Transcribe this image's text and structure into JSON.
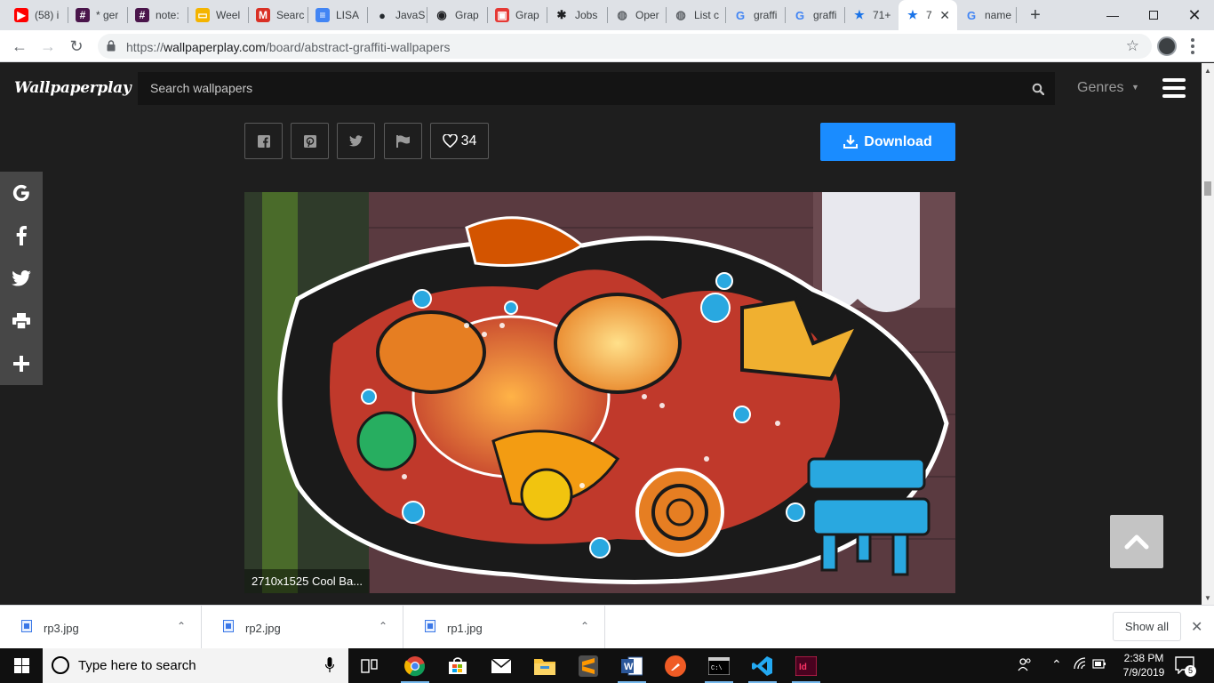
{
  "browser": {
    "tabs": [
      {
        "title": "(58) i",
        "icon": "youtube-icon",
        "color": "#ff0000",
        "glyph": "▶"
      },
      {
        "title": "* ger",
        "icon": "slack-icon",
        "color": "#4a154b",
        "glyph": "#"
      },
      {
        "title": "note:",
        "icon": "slack-icon",
        "color": "#4a154b",
        "glyph": "#"
      },
      {
        "title": "Weel",
        "icon": "slides-icon",
        "color": "#f4b400",
        "glyph": "▭"
      },
      {
        "title": "Searc",
        "icon": "gmail-icon",
        "color": "#d93025",
        "glyph": "M"
      },
      {
        "title": "LISA",
        "icon": "docs-icon",
        "color": "#4285f4",
        "glyph": "≡"
      },
      {
        "title": "JavaS",
        "icon": "github-icon",
        "color": "#24292e",
        "glyph": "●"
      },
      {
        "title": "Grap",
        "icon": "graphql-icon",
        "color": "#202124",
        "glyph": "◉"
      },
      {
        "title": "Grap",
        "icon": "bookmark-icon",
        "color": "#e53935",
        "glyph": "▣"
      },
      {
        "title": "Jobs",
        "icon": "jobs-icon",
        "color": "#202124",
        "glyph": "✱"
      },
      {
        "title": "Oper",
        "icon": "globe-icon",
        "color": "#5f6368",
        "glyph": "◍"
      },
      {
        "title": "List c",
        "icon": "globe-icon",
        "color": "#5f6368",
        "glyph": "◍"
      },
      {
        "title": "graffi",
        "icon": "google-icon",
        "color": "#4285f4",
        "glyph": "G"
      },
      {
        "title": "graffi",
        "icon": "google-icon",
        "color": "#4285f4",
        "glyph": "G"
      },
      {
        "title": "71+",
        "icon": "star-icon",
        "color": "#1a73e8",
        "glyph": "★"
      },
      {
        "title": "7",
        "icon": "star-icon",
        "color": "#1a73e8",
        "glyph": "★",
        "active": true
      },
      {
        "title": "name",
        "icon": "google-icon",
        "color": "#4285f4",
        "glyph": "G"
      }
    ],
    "url_scheme": "https://",
    "url_domain": "wallpaperplay.com",
    "url_path": "/board/abstract-graffiti-wallpapers"
  },
  "site": {
    "logo": "Wallpaperplay",
    "search_placeholder": "Search wallpapers",
    "genres_label": "Genres",
    "like_count": "34",
    "download_label": "Download",
    "image_caption": "2710x1525 Cool Ba...",
    "share_buttons": [
      "facebook-icon",
      "pinterest-icon",
      "twitter-icon",
      "flag-icon"
    ],
    "social_bar": [
      "google-icon",
      "facebook-icon",
      "twitter-icon",
      "print-icon",
      "plus-icon"
    ],
    "colors": {
      "download": "#1a8cff",
      "background": "#1e1e1e"
    }
  },
  "downloads": {
    "files": [
      "rp3.jpg",
      "rp2.jpg",
      "rp1.jpg"
    ],
    "show_all_label": "Show all"
  },
  "taskbar": {
    "search_placeholder": "Type here to search",
    "time": "2:38 PM",
    "date": "7/9/2019",
    "notification_count": "5"
  }
}
